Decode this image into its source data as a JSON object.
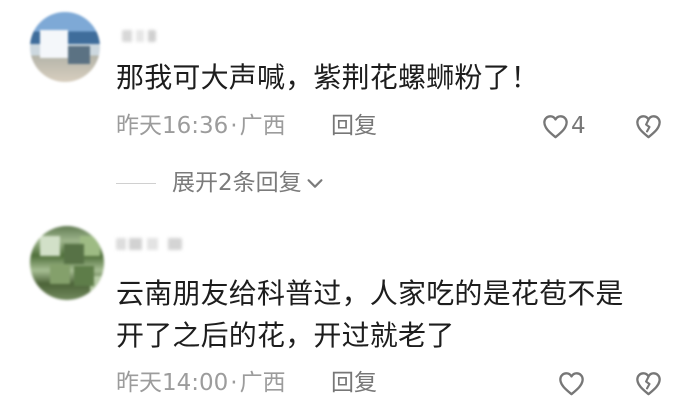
{
  "comments": [
    {
      "text": "那我可大声喊，紫荆花螺蛳粉了！",
      "time": "昨天16:36",
      "separator": "·",
      "location": "广西",
      "reply_label": "回复",
      "like_count": "4",
      "icons": {
        "like": "heart-outline-icon",
        "dislike": "broken-heart-icon"
      }
    },
    {
      "text_line_1": "云南朋友给科普过，人家吃的是花苞不是",
      "text_line_2": "开了之后的花，开过就老了",
      "time": "昨天14:00",
      "separator": "·",
      "location": "广西",
      "reply_label": "回复",
      "icons": {
        "like": "heart-outline-icon",
        "dislike": "broken-heart-icon"
      }
    }
  ],
  "replies": {
    "expand_label": "展开2条回复",
    "chevron_icon": "chevron-down-icon"
  },
  "colors": {
    "text_primary": "#1d1d1d",
    "text_secondary": "#9c9c9c",
    "text_action": "#777777"
  }
}
